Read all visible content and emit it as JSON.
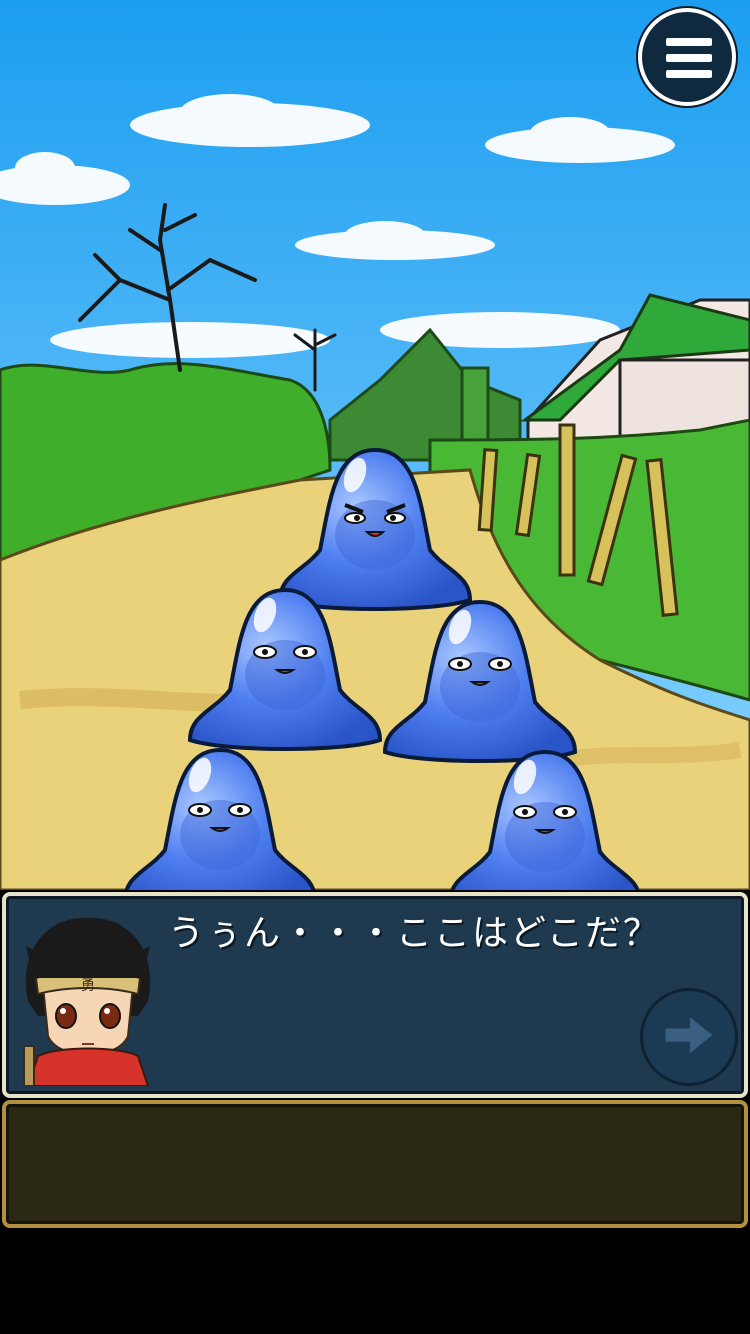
{
  "dialog": {
    "text": "うぅん・・・ここはどこだ？"
  },
  "message": {
    "text": ""
  },
  "colors": {
    "sky_top": "#1c9ef0",
    "sky_bottom": "#8fd6ff",
    "grass": "#3fae2a",
    "path": "#e9d27a",
    "slime": "#4f7ff0",
    "dialog_bg": "#1f3a4f",
    "message_bg": "#2a2812",
    "message_border": "#b3913c"
  },
  "icons": {
    "menu": "hamburger-icon",
    "next": "arrow-right-icon"
  }
}
